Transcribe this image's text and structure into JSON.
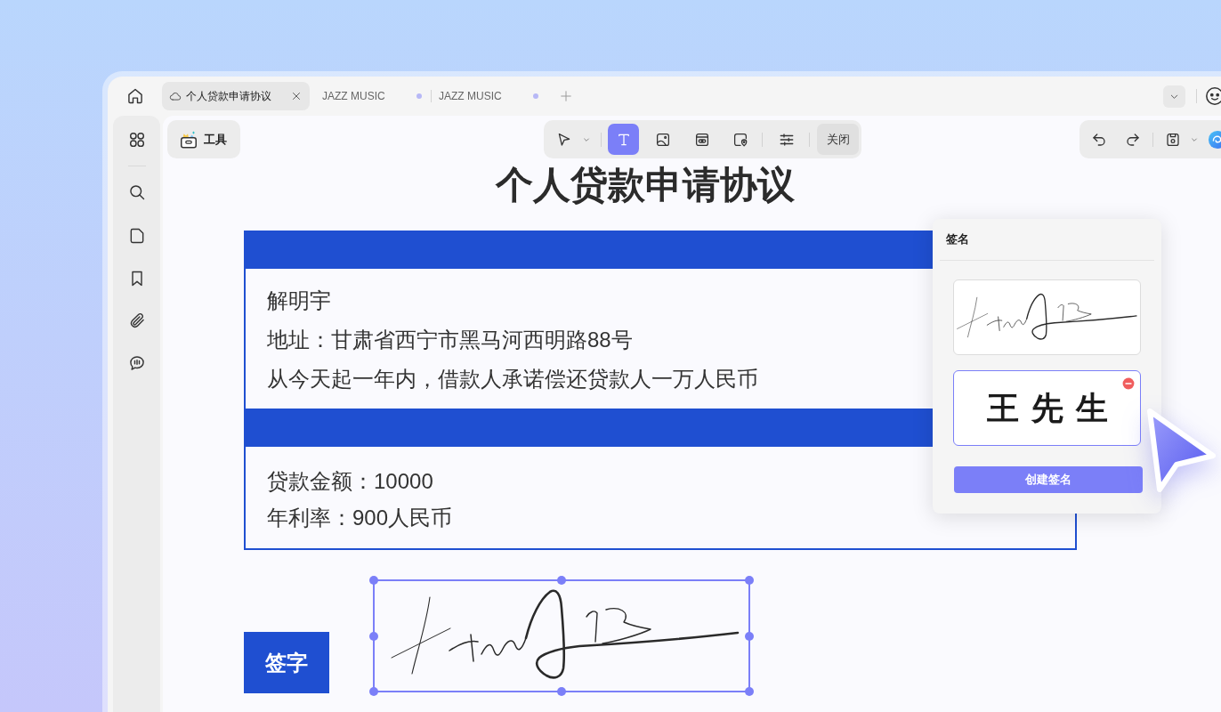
{
  "tabs": [
    {
      "label": "个人贷款申请协议",
      "selected": true,
      "cloud": true,
      "modified": false
    },
    {
      "label": "JAZZ MUSIC",
      "selected": false,
      "cloud": false,
      "modified": true
    },
    {
      "label": "JAZZ MUSIC",
      "selected": false,
      "cloud": false,
      "modified": true
    }
  ],
  "tools_button": {
    "label": "工具"
  },
  "toolbar": {
    "tools": [
      {
        "selected": false
      },
      {
        "selected": true
      },
      {
        "selected": false
      },
      {
        "selected": false
      },
      {
        "selected": false
      },
      {
        "selected": false
      }
    ],
    "close_button": "关闭"
  },
  "document": {
    "title": "个人贷款申请协议",
    "sections": [
      {
        "lines": [
          "解明宇",
          "地址：甘肃省西宁市黑马河西明路88号",
          "从今天起一年内，借款人承诺偿还贷款人一万人民币"
        ]
      },
      {
        "lines": [
          "贷款金额：10000",
          "年利率：900人民币"
        ]
      }
    ],
    "sign_button": "签字",
    "placed_signature": {
      "selected": true
    }
  },
  "signature_panel": {
    "title": "签名",
    "signatures": [
      {
        "kind": "drawing",
        "selected": false
      },
      {
        "kind": "text",
        "text": "王先生",
        "selected": true
      }
    ],
    "create_button": "创建签名"
  }
}
